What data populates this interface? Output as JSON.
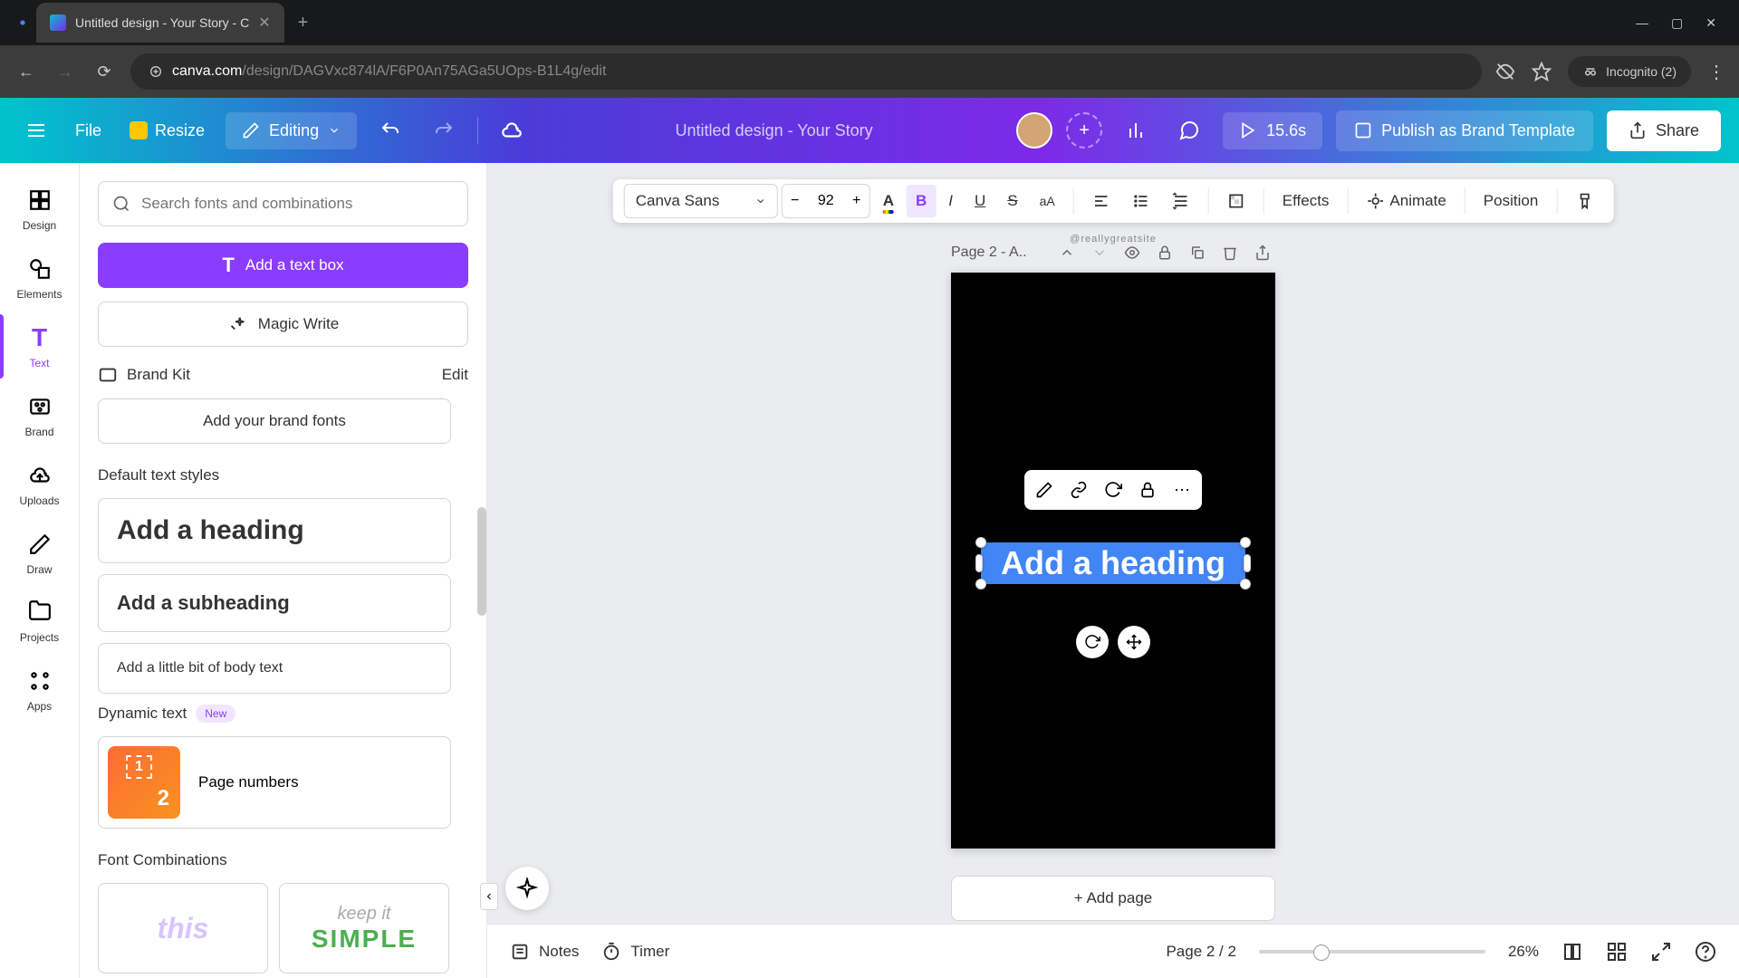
{
  "browser": {
    "tab_title": "Untitled design - Your Story - C",
    "url_domain": "canva.com",
    "url_path": "/design/DAGVxc874lA/F6P0An75AGa5UOps-B1L4g/edit",
    "incognito_label": "Incognito (2)"
  },
  "header": {
    "file": "File",
    "resize": "Resize",
    "editing": "Editing",
    "doc_title": "Untitled design - Your Story",
    "duration": "15.6s",
    "publish": "Publish as Brand Template",
    "share": "Share"
  },
  "rail": {
    "design": "Design",
    "elements": "Elements",
    "text": "Text",
    "brand": "Brand",
    "uploads": "Uploads",
    "draw": "Draw",
    "projects": "Projects",
    "apps": "Apps"
  },
  "panel": {
    "search_placeholder": "Search fonts and combinations",
    "add_text_box": "Add a text box",
    "magic_write": "Magic Write",
    "brand_kit": "Brand Kit",
    "edit": "Edit",
    "add_brand_fonts": "Add your brand fonts",
    "default_styles": "Default text styles",
    "heading": "Add a heading",
    "subheading": "Add a subheading",
    "body_text": "Add a little bit of body text",
    "dynamic_text": "Dynamic text",
    "new_badge": "New",
    "page_numbers": "Page numbers",
    "font_combinations": "Font Combinations",
    "combo1": "this",
    "combo2_line1": "keep it",
    "combo2_line2": "SIMPLE"
  },
  "toolbar": {
    "font": "Canva Sans",
    "size": "92",
    "effects": "Effects",
    "animate": "Animate",
    "position": "Position"
  },
  "canvas": {
    "page_label": "Page 2 - A..",
    "handle": "@reallygreatsite",
    "text_content": "Add a heading",
    "add_page": "+ Add page"
  },
  "footer": {
    "notes": "Notes",
    "timer": "Timer",
    "page_indicator": "Page 2 / 2",
    "zoom": "26%"
  }
}
